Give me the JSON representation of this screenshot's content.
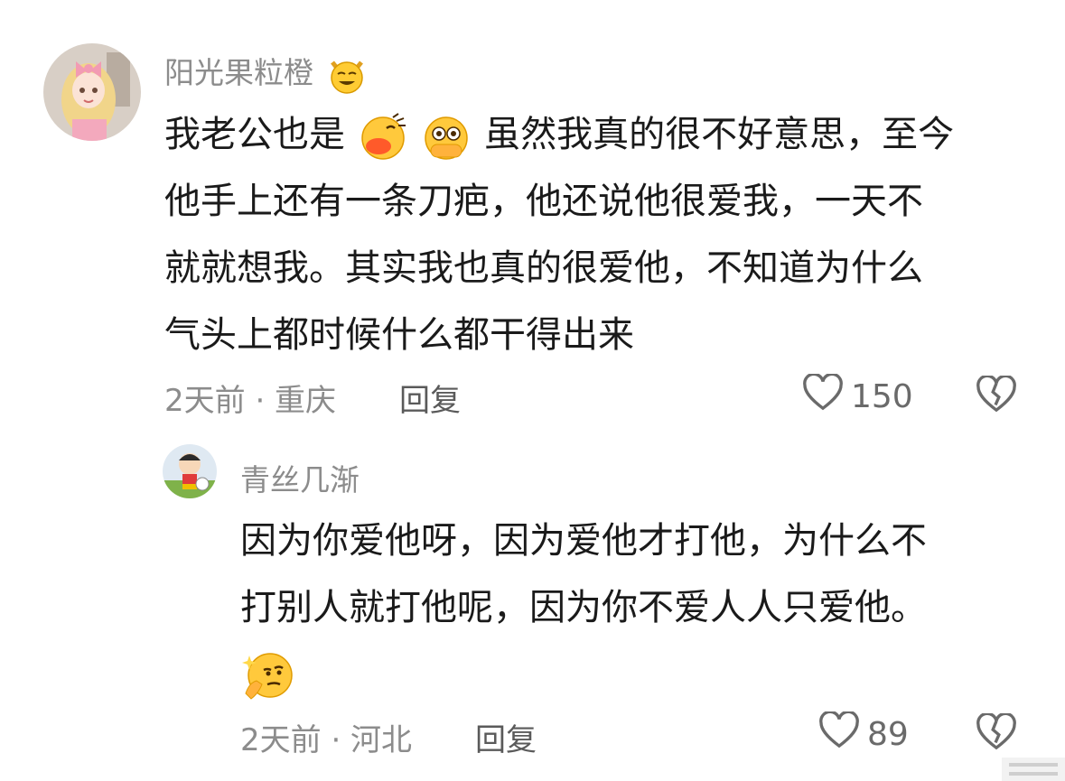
{
  "comment": {
    "username": "阳光果粒橙",
    "username_emoji": "cat-grin-icon",
    "lines": [
      "我老公也是",
      "他手上还有一条刀疤，他还说他很爱我，一天不",
      "就就想我。其实我也真的很爱他，不知道为什么",
      "气头上都时候什么都干得出来"
    ],
    "line1_suffix": "虽然我真的很不好意思，至今",
    "time_location": "2天前 · 重庆",
    "reply_label": "回复",
    "like_count": "150"
  },
  "reply": {
    "username": "青丝几渐",
    "lines": [
      "因为你爱他呀，因为爱他才打他，为什么不",
      "打别人就打他呢，因为你不爱人人只爱他。"
    ],
    "trailing_emoji": "thinking-face-icon",
    "time_location": "2天前 · 河北",
    "reply_label": "回复",
    "like_count": "89"
  },
  "colors": {
    "muted": "#8c8c8c",
    "text": "#1a1a1a",
    "emoji_yellow": "#ffc93c"
  }
}
